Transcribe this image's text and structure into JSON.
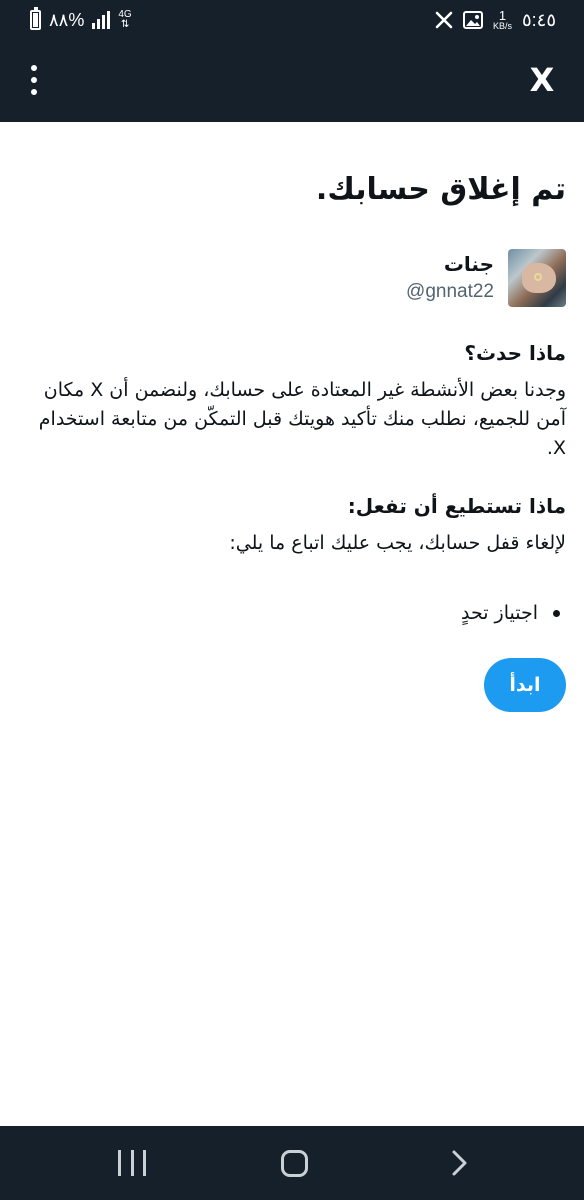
{
  "status_bar": {
    "time": "٥:٤٥",
    "net_speed_value": "1",
    "net_speed_unit": "KB/s",
    "network": "4G",
    "battery_percent": "٨٨%",
    "battery_level": 0.88,
    "icons": [
      "x-logo-icon",
      "image-icon",
      "signal-icon",
      "battery-icon"
    ]
  },
  "app_bar": {
    "close_label": "X",
    "icons": [
      "close-x-icon",
      "more-vertical-icon"
    ]
  },
  "page": {
    "title": "تم إغلاق حسابك.",
    "profile": {
      "name": "جنات",
      "handle": "@gnnat22"
    },
    "what_happened": {
      "title": "ماذا حدث؟",
      "body": "وجدنا بعض الأنشطة غير المعتادة على حسابك، ولنضمن أن X مكان آمن للجميع، نطلب منك تأكيد هويتك قبل التمكّن من متابعة استخدام X."
    },
    "what_to_do": {
      "title": "ماذا تستطيع أن تفعل:",
      "body": "لإلغاء قفل حسابك، يجب عليك اتباع ما يلي:",
      "steps": [
        "اجتياز تحدٍ"
      ]
    },
    "start_button": "ابدأ"
  },
  "colors": {
    "bar_background": "#15202b",
    "accent": "#1d9bf0",
    "text_primary": "#0f1419",
    "text_secondary": "#536471"
  }
}
